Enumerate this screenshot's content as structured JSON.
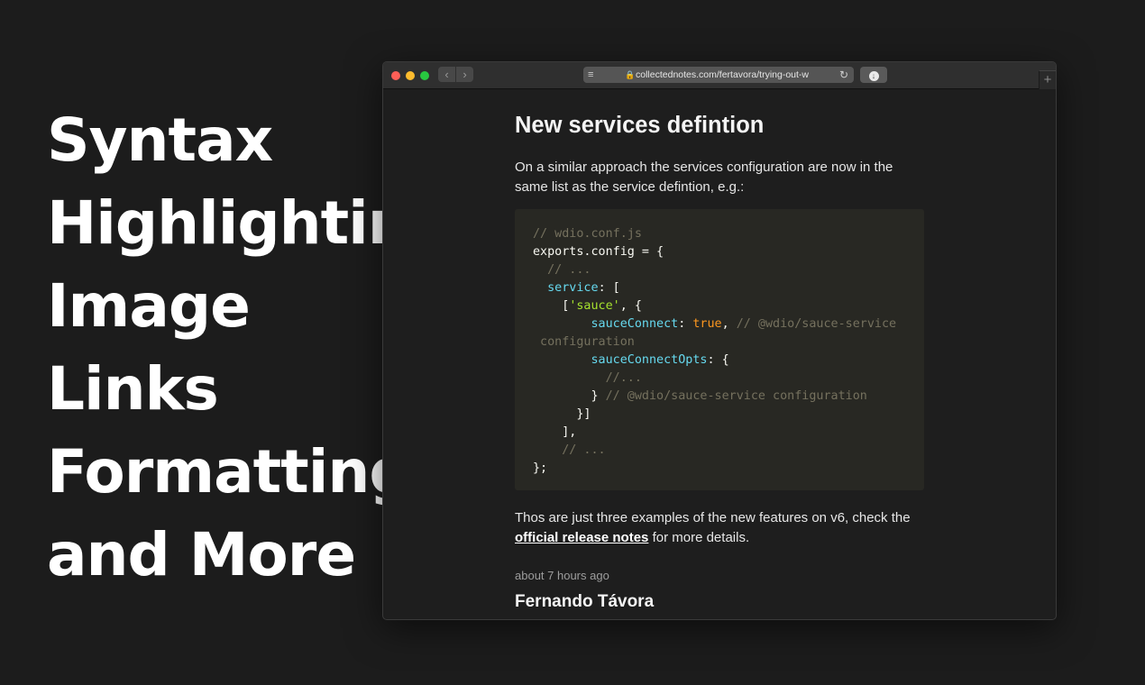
{
  "hero": {
    "lines": [
      "Syntax",
      "Highlighting",
      "Image",
      "Links",
      "Formatting",
      "and More"
    ]
  },
  "browser": {
    "url": "collectednotes.com/fertavora/trying-out-w",
    "icons": {
      "back": "chevron-left-icon",
      "forward": "chevron-right-icon",
      "reader": "reader-view-icon",
      "lock": "lock-icon",
      "reload": "reload-icon",
      "download": "download-icon",
      "new_tab": "plus-icon"
    }
  },
  "article": {
    "heading": "New services defintion",
    "intro": "On a similar approach the services configuration are now in the same list as the service defintion, e.g.:",
    "code_lines": [
      "// wdio.conf.js",
      "exports.config = {",
      "  // ...",
      "  service: [",
      "    ['sauce', {",
      "        sauceConnect: true, // @wdio/sauce-service",
      " configuration",
      "        sauceConnectOpts: {",
      "          //...",
      "        } // @wdio/sauce-service configuration",
      "      }]",
      "    ],",
      "    // ...",
      "};"
    ],
    "outro_before": "Thos are just three examples of the new features on v6, check the ",
    "outro_link": "official release notes",
    "outro_after": " for more details.",
    "timestamp": "about 7 hours ago",
    "author": "Fernando Távora"
  },
  "colors": {
    "page_bg": "#1c1c1c",
    "code_bg": "#282823",
    "comment": "#75715e",
    "keyword": "#66d9ef",
    "string": "#a6e22e",
    "boolean": "#fd971f"
  }
}
